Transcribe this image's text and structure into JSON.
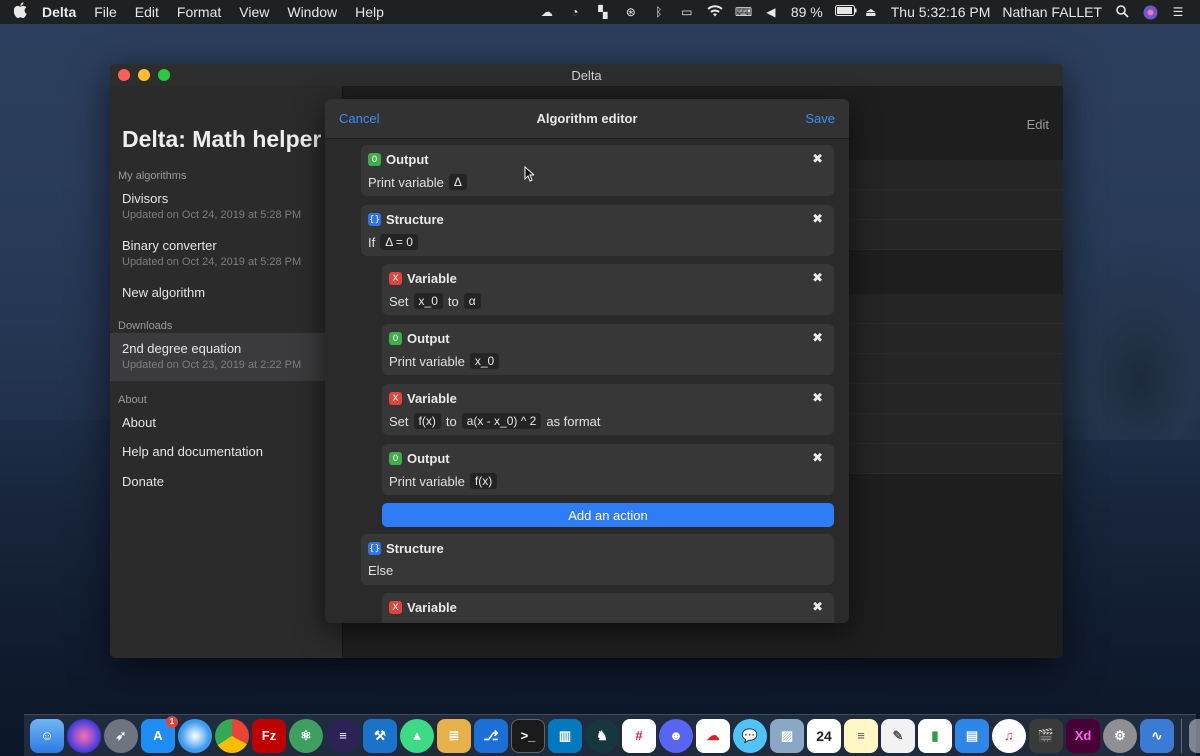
{
  "menubar": {
    "app_name": "Delta",
    "menus": [
      "File",
      "Edit",
      "Format",
      "View",
      "Window",
      "Help"
    ],
    "battery": "89 %",
    "clock": "Thu 5:32:16 PM",
    "user": "Nathan FALLET",
    "status_icons": [
      "creative-cloud-icon",
      "speedometer-icon",
      "tiles-icon",
      "shazam-icon",
      "bluetooth-icon",
      "airplay-icon",
      "wifi-icon",
      "keyboard-icon",
      "volume-icon"
    ]
  },
  "window": {
    "title": "Delta",
    "edit_label": "Edit"
  },
  "sidebar": {
    "title": "Delta: Math helper",
    "sections": {
      "my_algorithms": "My algorithms",
      "downloads": "Downloads",
      "about": "About"
    },
    "items": [
      {
        "label": "Divisors",
        "sub": "Updated on Oct 24, 2019 at 5:28 PM"
      },
      {
        "label": "Binary converter",
        "sub": "Updated on Oct 24, 2019 at 5:28 PM"
      },
      {
        "label": "New algorithm"
      },
      {
        "label": "2nd degree equation",
        "sub": "Updated on Oct 23, 2019 at 2:22 PM"
      },
      {
        "label": "About"
      },
      {
        "label": "Help and documentation"
      },
      {
        "label": "Donate"
      }
    ]
  },
  "modal": {
    "cancel": "Cancel",
    "title": "Algorithm editor",
    "save": "Save",
    "add_action": "Add an action",
    "close_glyph": "✖",
    "cards": [
      {
        "type": "Output",
        "badge": "0",
        "color": "green",
        "parts": [
          "Print variable",
          "Δ"
        ]
      },
      {
        "type": "Structure",
        "badge": "{}",
        "color": "blue",
        "parts": [
          "If",
          "Δ = 0"
        ]
      },
      {
        "type": "Variable",
        "badge": "X",
        "color": "red",
        "parts": [
          "Set",
          "x_0",
          "to",
          "α"
        ]
      },
      {
        "type": "Output",
        "badge": "0",
        "color": "green",
        "parts": [
          "Print variable",
          "x_0"
        ]
      },
      {
        "type": "Variable",
        "badge": "X",
        "color": "red",
        "parts": [
          "Set",
          "f(x)",
          "to",
          "a(x - x_0) ^ 2",
          "as format"
        ]
      },
      {
        "type": "Output",
        "badge": "0",
        "color": "green",
        "parts": [
          "Print variable",
          "f(x)"
        ]
      },
      {
        "type": "Structure",
        "badge": "{}",
        "color": "blue",
        "parts": [
          "Else"
        ]
      },
      {
        "type": "Variable",
        "badge": "X",
        "color": "red",
        "parts": []
      }
    ]
  },
  "dock": {
    "app_store_badge": "1",
    "calendar_day": "24",
    "items": [
      "finder-icon",
      "siri-icon",
      "launchpad-icon",
      "app-store-icon",
      "safari-icon",
      "chrome-icon",
      "filezilla-icon",
      "atom-icon",
      "eclipse-icon",
      "xcode-icon",
      "android-studio-icon",
      "sequel-icon",
      "sourcetree-icon",
      "terminal-icon",
      "trello-icon",
      "gitkraken-icon",
      "slack-icon",
      "discord-icon",
      "creative-cloud-dock-icon",
      "messages-icon",
      "preview-icon",
      "calendar-icon",
      "notes-icon",
      "textedit-icon",
      "numbers-icon",
      "keynote-icon",
      "music-icon",
      "final-cut-icon",
      "xd-icon",
      "system-preferences-icon",
      "sound-icon",
      "trash-icon"
    ]
  }
}
